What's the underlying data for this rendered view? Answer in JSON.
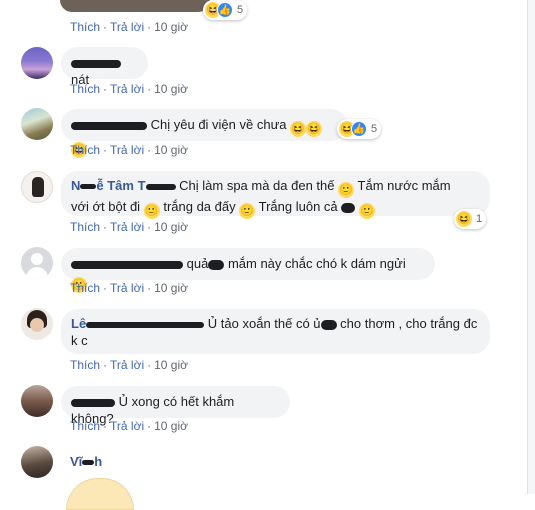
{
  "colors": {
    "link": "#4267b2",
    "bubble": "#f2f3f5",
    "name": "#385898",
    "meta": "#606770"
  },
  "actions": {
    "like": "Thích",
    "reply": "Trả lời",
    "sep": "·"
  },
  "top_reaction": {
    "count": "5",
    "time": "10 giờ"
  },
  "comments": [
    {
      "text": "nát",
      "time": "10 giờ"
    },
    {
      "text": "Chị yêu đi viện về chưa",
      "time": "10 giờ",
      "reaction_count": "5"
    },
    {
      "name_partial": "N",
      "name_partial2": "ễ  Tâm  T",
      "text1": "Chị làm spa mà da đen thế",
      "text2": "Tắm nước mắm",
      "text3": "với ớt bột đi",
      "text4": "trắng da đấy",
      "text5": "Trắng luôn cả",
      "time": "10 giờ",
      "reaction_count": "1"
    },
    {
      "text1": "quả",
      "text2": "mắm này chắc chó k dám ngửi",
      "time": "10 giờ"
    },
    {
      "name_partial": "Lê",
      "text1": "Ủ tảo xoắn thế có ủ",
      "text2": "cho thơm , cho trắng đc",
      "text3": "k c",
      "time": "10 giờ"
    },
    {
      "text": "Ủ xong có hết khắm không?",
      "time": "10 giờ"
    },
    {
      "name_partial": "Vĩ",
      "name_partial2": "h"
    }
  ],
  "icons": {
    "haha": "haha-icon",
    "like": "like-icon",
    "smile": "smile-icon"
  }
}
